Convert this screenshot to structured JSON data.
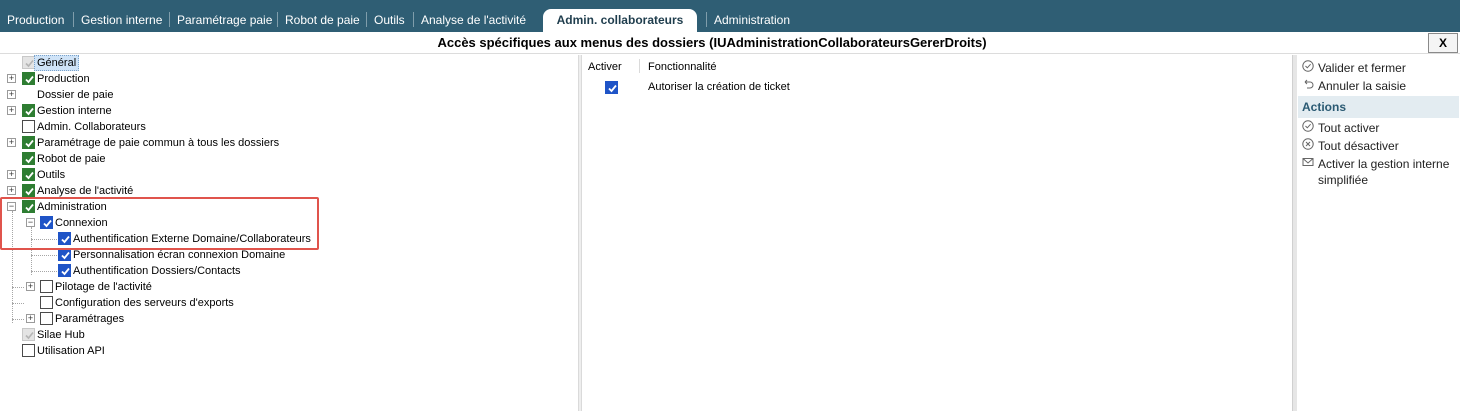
{
  "tabs": [
    {
      "label": "Production",
      "active": false
    },
    {
      "label": "Gestion interne",
      "active": false
    },
    {
      "label": "Paramétrage paie",
      "active": false
    },
    {
      "label": "Robot de paie",
      "active": false
    },
    {
      "label": "Outils",
      "active": false
    },
    {
      "label": "Analyse de l'activité",
      "active": false
    },
    {
      "label": "Admin. collaborateurs",
      "active": true
    },
    {
      "label": "Administration",
      "active": false
    }
  ],
  "window": {
    "title": "Accès spécifiques aux menus des dossiers (IUAdministrationCollaborateursGererDroits)",
    "close_label": "X"
  },
  "tree": {
    "nodes": [
      {
        "label": "Général",
        "checkbox": "grey",
        "expander": "",
        "selected": true
      },
      {
        "label": "Production",
        "checkbox": "green",
        "expander": "+"
      },
      {
        "label": "Dossier de paie",
        "checkbox": "none",
        "expander": "+"
      },
      {
        "label": "Gestion interne",
        "checkbox": "green",
        "expander": "+"
      },
      {
        "label": "Admin. Collaborateurs",
        "checkbox": "empty",
        "expander": ""
      },
      {
        "label": "Paramétrage de paie commun à tous les dossiers",
        "checkbox": "green",
        "expander": "+"
      },
      {
        "label": "Robot de paie",
        "checkbox": "green",
        "expander": ""
      },
      {
        "label": "Outils",
        "checkbox": "green",
        "expander": "+"
      },
      {
        "label": "Analyse de l'activité",
        "checkbox": "green",
        "expander": "+"
      },
      {
        "label": "Administration",
        "checkbox": "green",
        "expander": "−"
      },
      {
        "label": "Connexion",
        "checkbox": "blue",
        "expander": "−"
      },
      {
        "label": "Authentification Externe Domaine/Collaborateurs",
        "checkbox": "blue",
        "expander": ""
      },
      {
        "label": "Personnalisation écran connexion Domaine",
        "checkbox": "blue",
        "expander": ""
      },
      {
        "label": "Authentification Dossiers/Contacts",
        "checkbox": "blue",
        "expander": ""
      },
      {
        "label": "Pilotage de l'activité",
        "checkbox": "empty",
        "expander": "+"
      },
      {
        "label": "Configuration des serveurs d'exports",
        "checkbox": "empty",
        "expander": ""
      },
      {
        "label": "Paramétrages",
        "checkbox": "empty",
        "expander": "+"
      },
      {
        "label": "Silae Hub",
        "checkbox": "grey",
        "expander": ""
      },
      {
        "label": "Utilisation API",
        "checkbox": "empty",
        "expander": ""
      }
    ]
  },
  "grid": {
    "columns": [
      "Activer",
      "Fonctionnalité"
    ],
    "rows": [
      {
        "checked": true,
        "feature": "Autoriser la création de ticket"
      }
    ]
  },
  "actions": {
    "top": [
      {
        "label": "Valider et fermer",
        "icon": "check-circle-icon"
      },
      {
        "label": "Annuler la saisie",
        "icon": "undo-icon"
      }
    ],
    "section_title": "Actions",
    "items": [
      {
        "label": "Tout activer",
        "icon": "check-circle-icon"
      },
      {
        "label": "Tout désactiver",
        "icon": "x-circle-icon"
      },
      {
        "label": "Activer la gestion interne",
        "label2": "simplifiée",
        "icon": "envelope-icon"
      }
    ]
  },
  "colors": {
    "tabbar": "#2f5e74",
    "check_green": "#2e7d32",
    "check_blue": "#1f54c7",
    "highlight": "#e0544c"
  }
}
